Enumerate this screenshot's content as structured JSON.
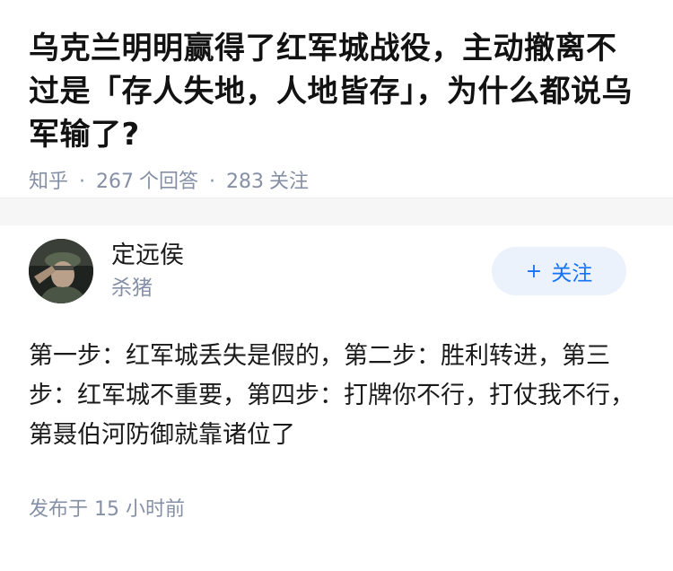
{
  "question": {
    "title": "乌克兰明明赢得了红军城战役，主动撤离不过是「存人失地，人地皆存」，为什么都说乌军输了?",
    "source": "知乎",
    "separator": "·",
    "answer_count": "267",
    "answer_label": "个回答",
    "follow_count": "283",
    "follow_label": "关注"
  },
  "answer": {
    "author_name": "定远侯",
    "author_bio": "杀猪",
    "follow_button": {
      "icon": "plus-icon",
      "plus": "+",
      "label": "关注"
    },
    "content": "第一步：红军城丢失是假的，第二步：胜利转进，第三步：红军城不重要，第四步：打牌你不行，打仗我不行，第聂伯河防御就靠诸位了",
    "time": "发布于 15 小时前"
  },
  "colors": {
    "meta_gray": "#8590a6",
    "accent_blue": "#1772f6",
    "follow_bg": "#ebf2fb",
    "divider_bg": "#f6f6f6"
  }
}
